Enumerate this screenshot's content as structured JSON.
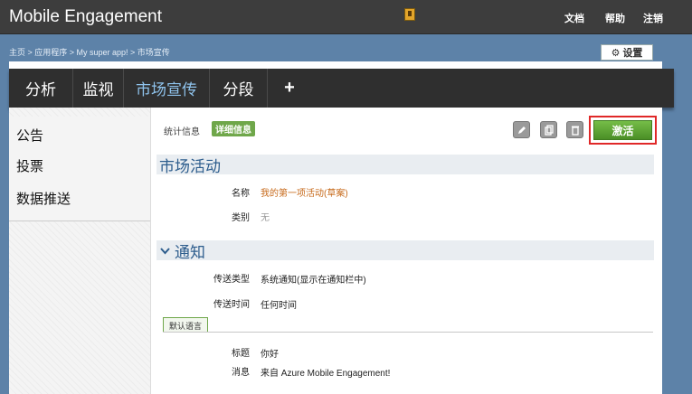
{
  "header": {
    "title": "Mobile Engagement",
    "app_icon": "app-badge-icon",
    "links": [
      "文档",
      "帮助",
      "注销"
    ]
  },
  "breadcrumb": "主页 > 应用程序 > My super app! > 市场宣传",
  "settings": {
    "label": "设置",
    "icon": "gear-icon"
  },
  "tabs": [
    {
      "label": "分析",
      "active": false
    },
    {
      "label": "监视",
      "active": false
    },
    {
      "label": "市场宣传",
      "active": true
    },
    {
      "label": "分段",
      "active": false
    },
    {
      "label": "+",
      "active": false
    }
  ],
  "sidebar": {
    "items": [
      "公告",
      "投票",
      "数据推送"
    ]
  },
  "content": {
    "subtabs": {
      "stats": "统计信息",
      "details": "详细信息"
    },
    "toolbar_icons": [
      "edit-icon",
      "copy-icon",
      "delete-icon"
    ],
    "activate_label": "激活",
    "campaign_section": {
      "title": "市场活动",
      "fields": [
        {
          "label": "名称",
          "value": "我的第一项活动(草案)"
        },
        {
          "label": "类别",
          "value": "无"
        }
      ]
    },
    "notification_section": {
      "title": "通知",
      "fields": [
        {
          "label": "传送类型",
          "value": "系统通知(显示在通知栏中)"
        },
        {
          "label": "传送时间",
          "value": "任何时间"
        }
      ],
      "lang_tab": "默认语言",
      "message_fields": [
        {
          "label": "标题",
          "value": "你好"
        },
        {
          "label": "消息",
          "value": "来自 Azure Mobile Engagement!"
        }
      ]
    }
  },
  "colors": {
    "topbar": "#3d3d3d",
    "background": "#5d82a8",
    "active_tab": "#8fc3ec",
    "green": "#5fa535",
    "highlight": "#e02828",
    "section_title": "#2d5d8d",
    "orange_value": "#c76a1b"
  }
}
